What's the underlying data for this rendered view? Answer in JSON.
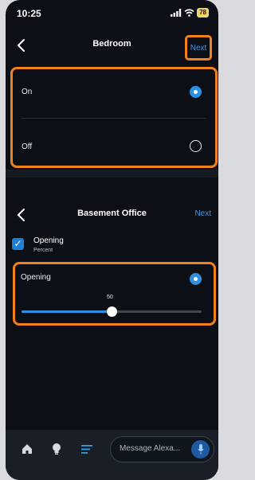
{
  "status_bar": {
    "time": "10:25",
    "battery": "78"
  },
  "top_panel": {
    "title": "Bedroom",
    "next_label": "Next",
    "options": [
      {
        "label": "On",
        "selected": true
      },
      {
        "label": "Off",
        "selected": false
      }
    ]
  },
  "bottom_panel": {
    "title": "Basement Office",
    "next_label": "Next",
    "checkbox": {
      "label": "Opening",
      "sublabel": "Percent",
      "checked": true
    },
    "option": {
      "label": "Opening",
      "selected": true
    },
    "slider": {
      "value": "50",
      "min": 0,
      "max": 100,
      "level": 50
    }
  },
  "bottom_bar": {
    "message_placeholder": "Message Alexa...",
    "icons": [
      "home-icon",
      "lightbulb-icon",
      "menu-icon",
      "mic-icon"
    ]
  },
  "colors": {
    "accent": "#2f8fe0",
    "highlight": "#f2801d",
    "background": "#0c1016"
  }
}
